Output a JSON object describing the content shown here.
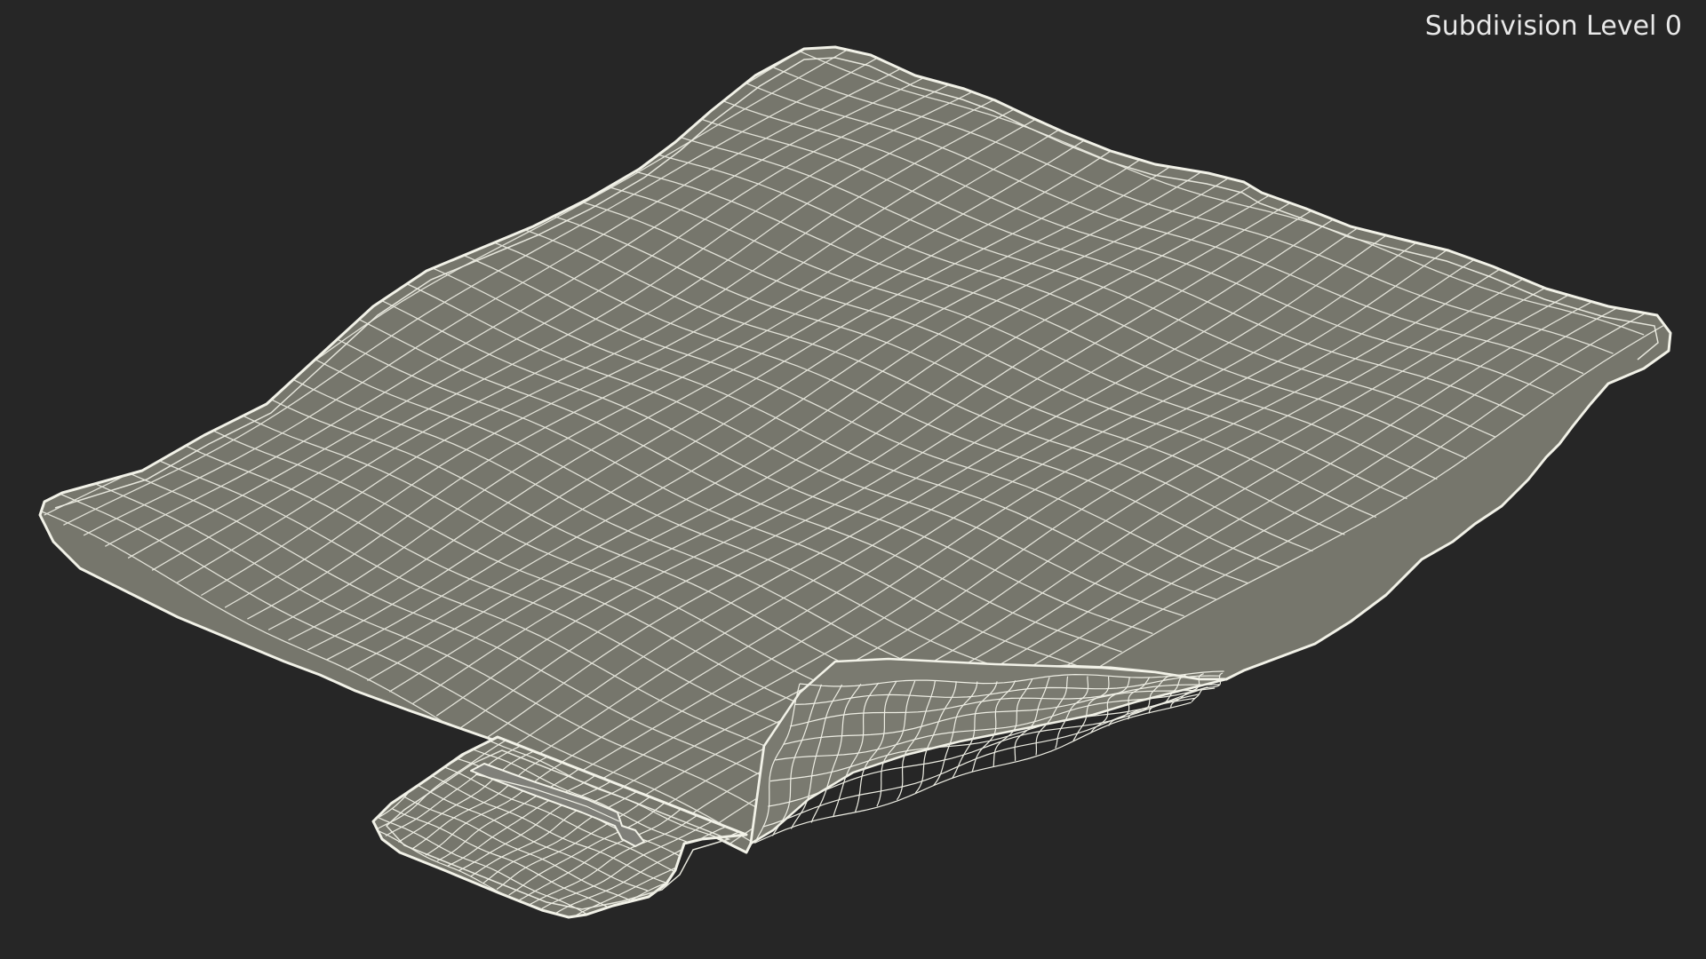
{
  "viewport": {
    "background_color": "#262626",
    "subdivision_label": "Subdivision Level 0"
  },
  "model": {
    "name": "cloth-mat-with-handle-wireframe",
    "surface_color": "#76766c",
    "wire_color": "#f2f2e8"
  }
}
